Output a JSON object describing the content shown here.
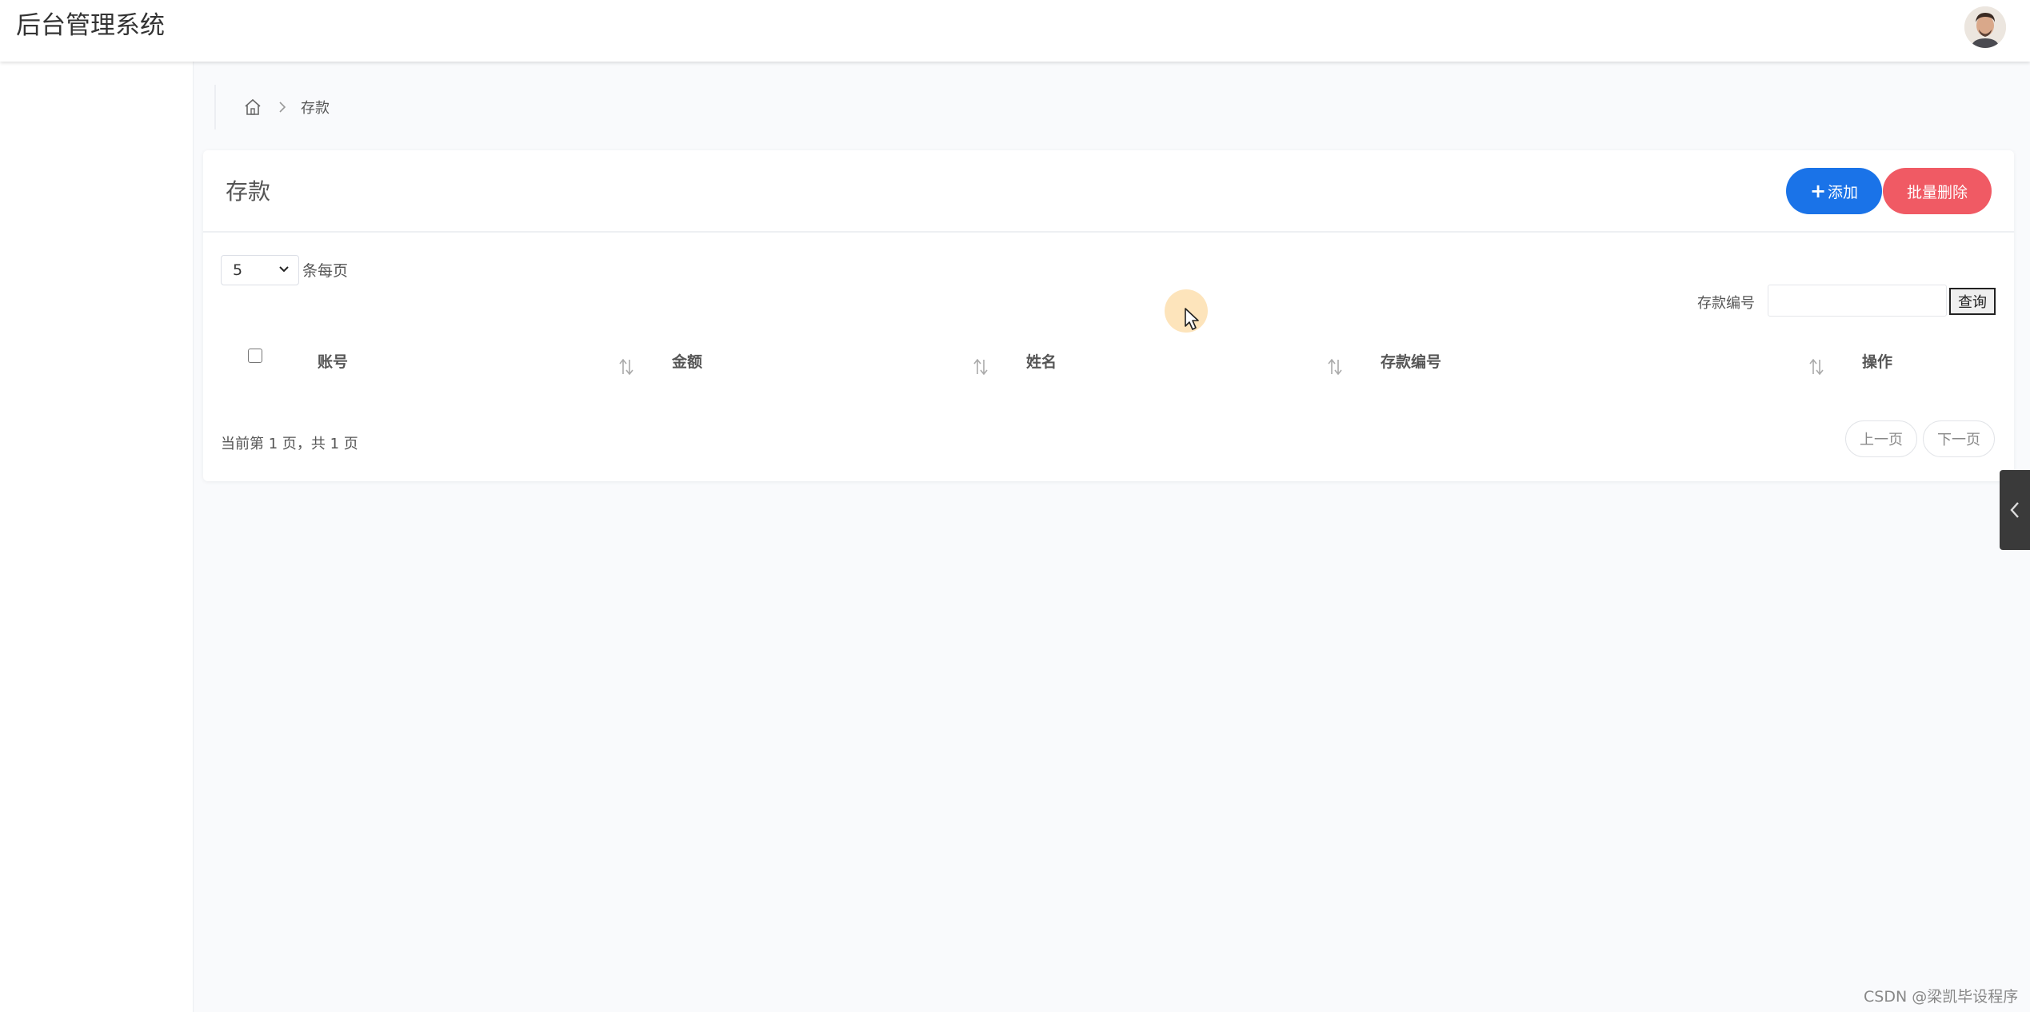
{
  "header": {
    "app_title": "后台管理系统"
  },
  "breadcrumb": {
    "home_icon": "home-icon",
    "current": "存款"
  },
  "card": {
    "title": "存款",
    "add_label": "添加",
    "batch_delete_label": "批量删除",
    "accent_color": "#1a73e8",
    "danger_color": "#f05a64"
  },
  "controls": {
    "page_size_value": "5",
    "page_size_label": "条每页",
    "search_label": "存款编号",
    "search_value": "",
    "search_button": "查询"
  },
  "table": {
    "columns": [
      "账号",
      "金额",
      "姓名",
      "存款编号",
      "操作"
    ],
    "rows": []
  },
  "pagination": {
    "info": "当前第 1 页，共 1 页",
    "prev_label": "上一页",
    "next_label": "下一页"
  },
  "watermark": "CSDN @梁凯毕设程序"
}
